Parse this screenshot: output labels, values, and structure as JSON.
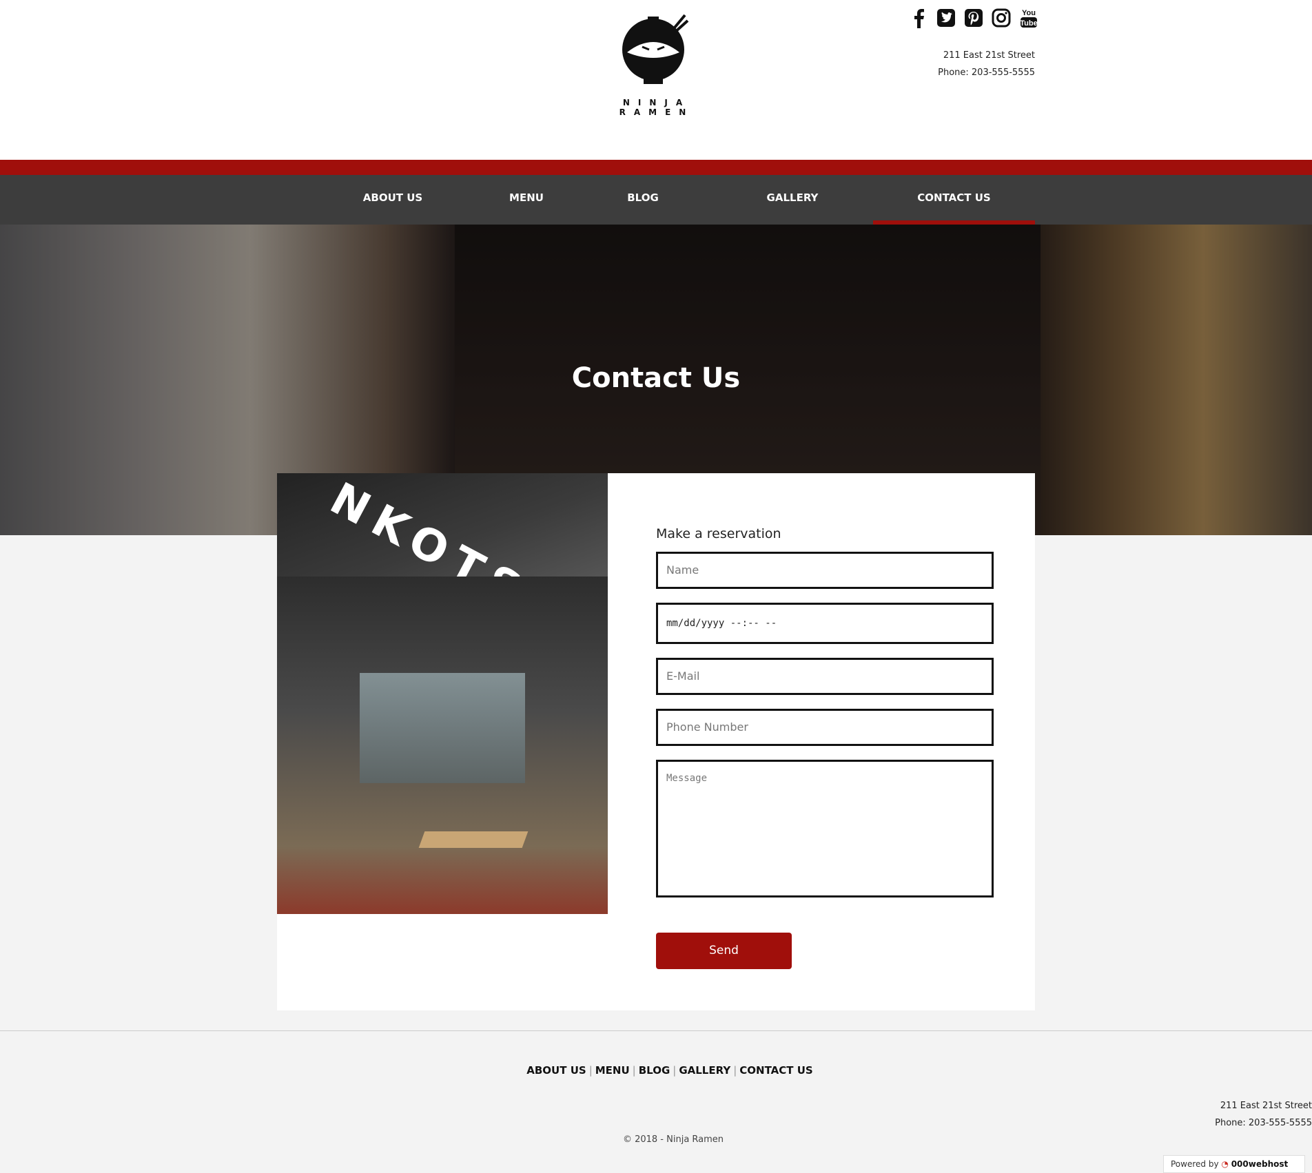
{
  "brand": {
    "name": "NINJA RAMEN"
  },
  "header": {
    "address": "211 East 21st Street",
    "phone": "Phone: 203-555-5555",
    "social": [
      "facebook-icon",
      "twitter-icon",
      "pinterest-icon",
      "instagram-icon",
      "youtube-icon"
    ]
  },
  "nav": {
    "items": [
      {
        "label": "ABOUT US"
      },
      {
        "label": "MENU"
      },
      {
        "label": "BLOG"
      },
      {
        "label": "GALLERY"
      },
      {
        "label": "CONTACT US",
        "active": true
      }
    ]
  },
  "hero": {
    "title": "Contact Us"
  },
  "photo": {
    "sign": "NKOTSU"
  },
  "form": {
    "title": "Make a reservation",
    "name_placeholder": "Name",
    "date_value": "mm/dd/yyyy --:-- --",
    "email_placeholder": "E-Mail",
    "phone_placeholder": "Phone Number",
    "message_placeholder": "Message",
    "send_label": "Send"
  },
  "footer": {
    "links": [
      "ABOUT US",
      "MENU",
      "BLOG",
      "GALLERY",
      "CONTACT US"
    ],
    "address": "211 East 21st Street",
    "phone": "Phone: 203-555-5555",
    "copyright": "© 2018 - Ninja Ramen",
    "badge_powered": "Powered by",
    "badge_host": "000webhost"
  },
  "colors": {
    "accent": "#a00f0b",
    "nav": "#3d3d3d"
  }
}
